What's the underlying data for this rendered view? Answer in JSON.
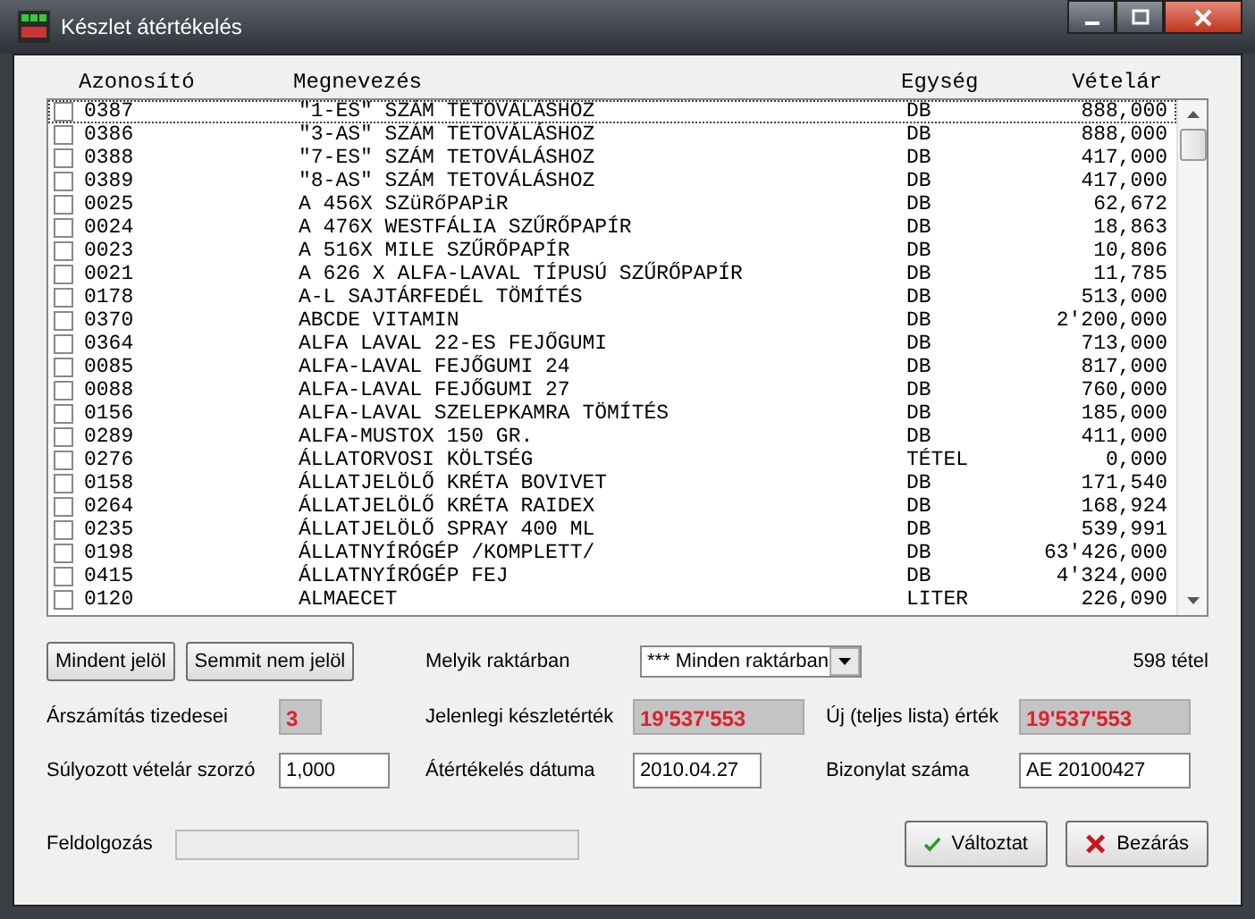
{
  "window": {
    "title": "Készlet átértékelés"
  },
  "table": {
    "columns": [
      {
        "label": "Azonosító"
      },
      {
        "label": "Megnevezés"
      },
      {
        "label": "Egység"
      },
      {
        "label": "Vételár"
      }
    ],
    "rows": [
      {
        "checked": false,
        "selected": true,
        "cells": [
          "0387",
          "\"1-ES\" SZÁM TETOVÁLÁSHOZ",
          "DB",
          "888,000"
        ]
      },
      {
        "checked": false,
        "selected": false,
        "cells": [
          "0386",
          "\"3-AS\" SZÁM TETOVÁLÁSHOZ",
          "DB",
          "888,000"
        ]
      },
      {
        "checked": false,
        "selected": false,
        "cells": [
          "0388",
          "\"7-ES\" SZÁM TETOVÁLÁSHOZ",
          "DB",
          "417,000"
        ]
      },
      {
        "checked": false,
        "selected": false,
        "cells": [
          "0389",
          "\"8-AS\" SZÁM TETOVÁLÁSHOZ",
          "DB",
          "417,000"
        ]
      },
      {
        "checked": false,
        "selected": false,
        "cells": [
          "0025",
          "A 456X SZüRőPAPiR",
          "DB",
          "62,672"
        ]
      },
      {
        "checked": false,
        "selected": false,
        "cells": [
          "0024",
          "A 476X WESTFÁLIA SZŰRŐPAPÍR",
          "DB",
          "18,863"
        ]
      },
      {
        "checked": false,
        "selected": false,
        "cells": [
          "0023",
          "A 516X MILE SZŰRŐPAPÍR",
          "DB",
          "10,806"
        ]
      },
      {
        "checked": false,
        "selected": false,
        "cells": [
          "0021",
          "A 626 X ALFA-LAVAL TÍPUSÚ SZŰRŐPAPÍR",
          "DB",
          "11,785"
        ]
      },
      {
        "checked": false,
        "selected": false,
        "cells": [
          "0178",
          "A-L SAJTÁRFEDÉL TÖMÍTÉS",
          "DB",
          "513,000"
        ]
      },
      {
        "checked": false,
        "selected": false,
        "cells": [
          "0370",
          "ABCDE VITAMIN",
          "DB",
          "2'200,000"
        ]
      },
      {
        "checked": false,
        "selected": false,
        "cells": [
          "0364",
          "ALFA LAVAL 22-ES FEJŐGUMI",
          "DB",
          "713,000"
        ]
      },
      {
        "checked": false,
        "selected": false,
        "cells": [
          "0085",
          "ALFA-LAVAL FEJŐGUMI 24",
          "DB",
          "817,000"
        ]
      },
      {
        "checked": false,
        "selected": false,
        "cells": [
          "0088",
          "ALFA-LAVAL FEJŐGUMI 27",
          "DB",
          "760,000"
        ]
      },
      {
        "checked": false,
        "selected": false,
        "cells": [
          "0156",
          "ALFA-LAVAL SZELEPKAMRA TÖMÍTÉS",
          "DB",
          "185,000"
        ]
      },
      {
        "checked": false,
        "selected": false,
        "cells": [
          "0289",
          "ALFA-MUSTOX 150 GR.",
          "DB",
          "411,000"
        ]
      },
      {
        "checked": false,
        "selected": false,
        "cells": [
          "0276",
          "ÁLLATORVOSI KÖLTSÉG",
          "TÉTEL",
          "0,000"
        ]
      },
      {
        "checked": false,
        "selected": false,
        "cells": [
          "0158",
          "ÁLLATJELÖLŐ KRÉTA BOVIVET",
          "DB",
          "171,540"
        ]
      },
      {
        "checked": false,
        "selected": false,
        "cells": [
          "0264",
          "ÁLLATJELÖLŐ KRÉTA RAIDEX",
          "DB",
          "168,924"
        ]
      },
      {
        "checked": false,
        "selected": false,
        "cells": [
          "0235",
          "ÁLLATJELÖLŐ SPRAY 400 ML",
          "DB",
          "539,991"
        ]
      },
      {
        "checked": false,
        "selected": false,
        "cells": [
          "0198",
          "ÁLLATNYÍRÓGÉP /KOMPLETT/",
          "DB",
          "63'426,000"
        ]
      },
      {
        "checked": false,
        "selected": false,
        "cells": [
          "0415",
          "ÁLLATNYÍRÓGÉP FEJ",
          "DB",
          "4'324,000"
        ]
      },
      {
        "checked": false,
        "selected": false,
        "cells": [
          "0120",
          "ALMAECET",
          "LITER",
          "226,090"
        ]
      }
    ]
  },
  "buttons": {
    "select_all": "Mindent jelöl",
    "select_none": "Semmit nem jelöl"
  },
  "warehouse": {
    "label": "Melyik raktárban",
    "value": "*** Minden raktárban"
  },
  "count": "598 tétel",
  "fields": [
    {
      "label": "Árszámítás tizedesei",
      "value": "3",
      "kind": "readonly"
    },
    {
      "label": "Jelenlegi készletérték",
      "value": "19'537'553",
      "kind": "readonly"
    },
    {
      "label": "Új (teljes lista) érték",
      "value": "19'537'553",
      "kind": "readonly"
    },
    {
      "label": "Súlyozott vételár szorzó",
      "value": "1,000",
      "kind": "input"
    },
    {
      "label": "Átértékelés dátuma",
      "value": "2010.04.27",
      "kind": "input"
    },
    {
      "label": "Bizonylat száma",
      "value": "AE 20100427",
      "kind": "input"
    }
  ],
  "progress": {
    "label": "Feldolgozás",
    "level": 0
  },
  "actions": [
    {
      "label": "Változtat",
      "kind": "ok"
    },
    {
      "label": "Bezárás",
      "kind": "close"
    }
  ]
}
